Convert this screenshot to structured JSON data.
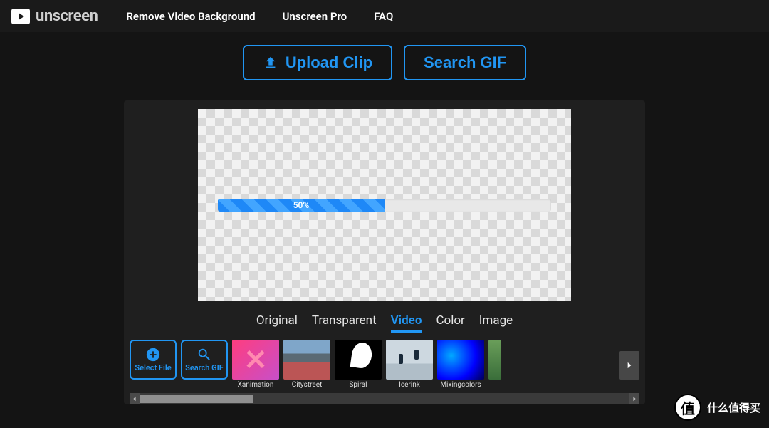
{
  "brand": "unscreen",
  "nav": {
    "remove_bg": "Remove Video Background",
    "pro": "Unscreen Pro",
    "faq": "FAQ"
  },
  "actions": {
    "upload": "Upload Clip",
    "search_gif": "Search GIF"
  },
  "progress": {
    "percent": 50,
    "label": "50%"
  },
  "tabs": {
    "original": "Original",
    "transparent": "Transparent",
    "video": "Video",
    "color": "Color",
    "image": "Image",
    "active": "video"
  },
  "tile": {
    "select_file": "Select File",
    "search_gif": "Search GIF"
  },
  "thumbs": [
    {
      "label": "Xanimation",
      "style": "tx-xanim"
    },
    {
      "label": "Citystreet",
      "style": "tx-city"
    },
    {
      "label": "Spiral",
      "style": "tx-spiral"
    },
    {
      "label": "Icerink",
      "style": "tx-ice"
    },
    {
      "label": "Mixingcolors",
      "style": "tx-mix"
    }
  ],
  "watermark": {
    "badge": "值",
    "text": "什么值得买"
  }
}
